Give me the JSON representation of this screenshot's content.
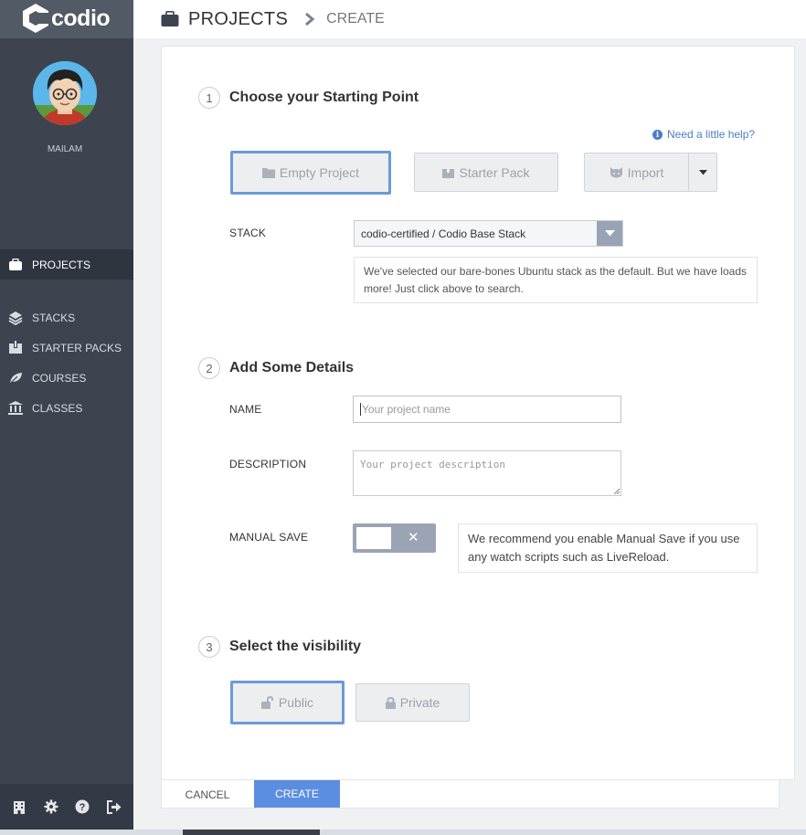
{
  "app": {
    "logo_text": "codio"
  },
  "user": {
    "name": "MAILAM"
  },
  "sidebar": {
    "items": [
      {
        "label": "PROJECTS",
        "icon": "briefcase-icon",
        "active": true
      },
      {
        "label": "STACKS",
        "icon": "layers-icon"
      },
      {
        "label": "STARTER PACKS",
        "icon": "box-icon"
      },
      {
        "label": "COURSES",
        "icon": "leaf-icon"
      },
      {
        "label": "CLASSES",
        "icon": "institution-icon"
      }
    ],
    "bottom_icons": [
      "building-icon",
      "gear-icon",
      "help-icon",
      "logout-icon"
    ]
  },
  "header": {
    "title": "PROJECTS",
    "crumb": "CREATE"
  },
  "step1": {
    "number": "1",
    "title": "Choose your Starting Point",
    "help_link": "Need a little help?",
    "options": {
      "empty": "Empty Project",
      "starter": "Starter Pack",
      "import": "Import"
    },
    "stack_label": "STACK",
    "stack_value": "codio-certified / Codio Base Stack",
    "stack_tip": "We've selected our bare-bones Ubuntu stack as the default. But we have loads more! Just click above to search."
  },
  "step2": {
    "number": "2",
    "title": "Add Some Details",
    "name_label": "NAME",
    "name_placeholder": "Your project name",
    "description_label": "DESCRIPTION",
    "description_placeholder": "Your project description",
    "manual_save_label": "MANUAL SAVE",
    "manual_save_enabled": false,
    "manual_save_tip": "We recommend you enable Manual Save if you use any watch scripts such as LiveReload."
  },
  "step3": {
    "number": "3",
    "title": "Select the visibility",
    "public": "Public",
    "private": "Private"
  },
  "footer": {
    "cancel": "CANCEL",
    "create": "CREATE"
  },
  "colors": {
    "sidebar": "#3d4450",
    "accent": "#5b8ee0",
    "selected_border": "#6b9ad8"
  }
}
